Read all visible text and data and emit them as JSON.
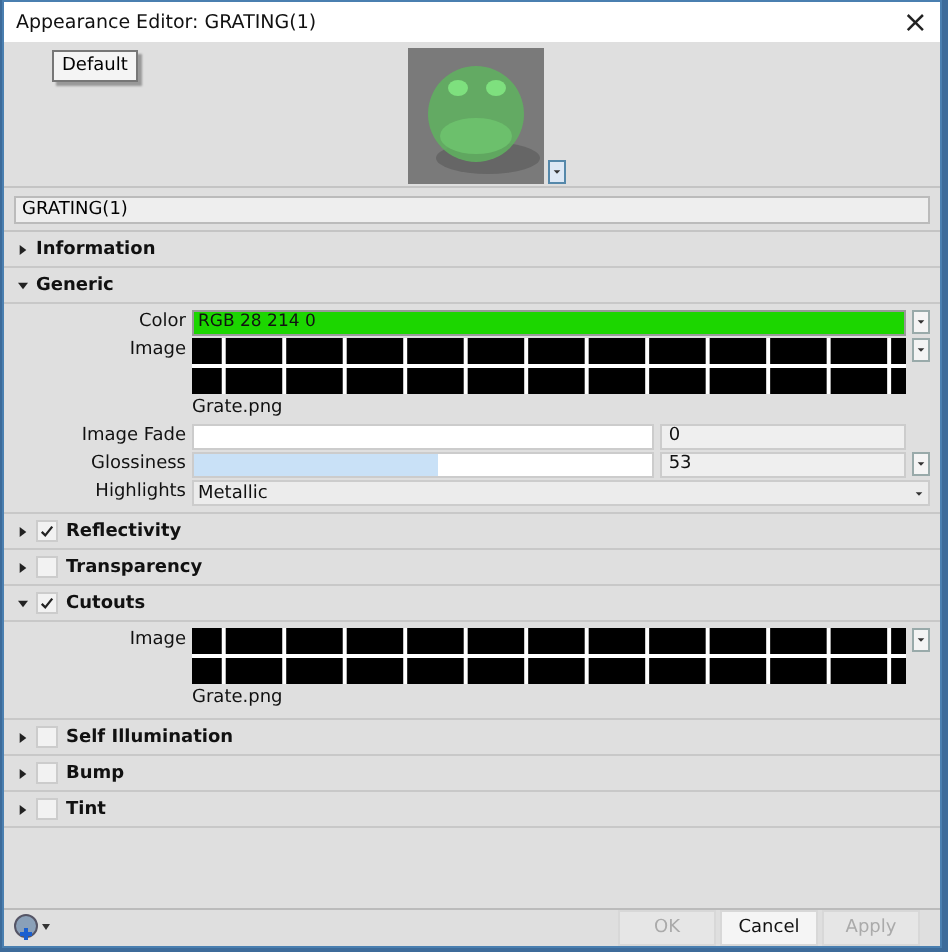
{
  "window": {
    "title": "Appearance Editor: GRATING(1)",
    "close": "×"
  },
  "preset_button": "Default",
  "name_field": {
    "value": "GRATING(1)"
  },
  "sections": [
    {
      "label": "Information",
      "kind": "plain",
      "expanded": false
    },
    {
      "label": "Generic",
      "kind": "plain",
      "expanded": true,
      "fields": [
        {
          "kind": "color",
          "label": "Color",
          "value": "RGB 28 214 0",
          "color": "#1cd600"
        },
        {
          "label": "Image",
          "file": "Grate.png"
        },
        {
          "kind": "slider",
          "label": "Image Fade",
          "level": 0,
          "value": "0",
          "menu": false
        },
        {
          "kind": "slider",
          "label": "Glossiness",
          "level": 0.53,
          "value": "53",
          "menu": true
        },
        {
          "kind": "dropdown",
          "label": "Highlights",
          "value": "Metallic"
        }
      ]
    },
    {
      "label": "Reflectivity",
      "kind": "checkable",
      "expanded": false,
      "checked": true
    },
    {
      "label": "Transparency",
      "kind": "checkable",
      "expanded": false,
      "checked": false
    },
    {
      "label": "Cutouts",
      "kind": "checkable",
      "expanded": true,
      "checked": true,
      "fields": [
        {
          "label": "Image",
          "file": "Grate.png"
        }
      ]
    },
    {
      "label": "Self Illumination",
      "kind": "checkable",
      "expanded": false,
      "checked": false
    },
    {
      "label": "Bump",
      "kind": "checkable",
      "expanded": false,
      "checked": false
    },
    {
      "label": "Tint",
      "kind": "checkable",
      "expanded": false,
      "checked": false
    }
  ],
  "buttons": [
    {
      "label": "OK",
      "disabled": true
    },
    {
      "label": "Cancel",
      "disabled": false
    },
    {
      "label": "Apply",
      "disabled": true
    }
  ]
}
